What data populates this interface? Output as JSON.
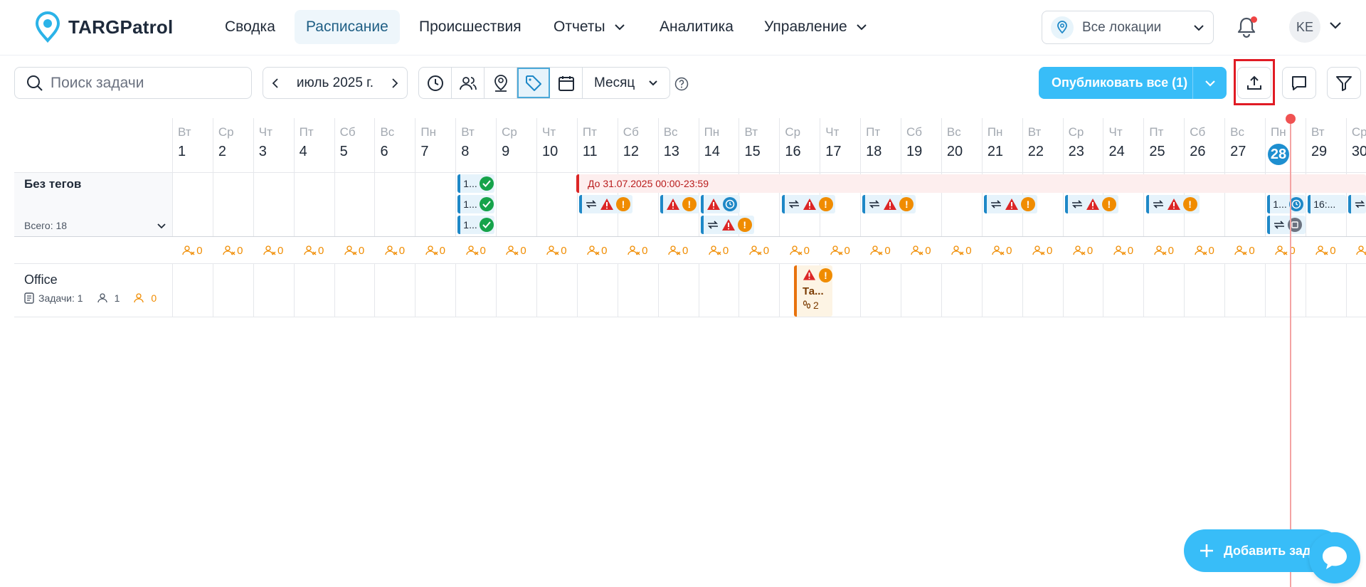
{
  "app": {
    "brand": "TARGPatrol",
    "accent": "#38bdf8",
    "brand_blue": "#1e88c7"
  },
  "nav": {
    "items": [
      {
        "label": "Сводка",
        "active": false,
        "dropdown": false
      },
      {
        "label": "Расписание",
        "active": true,
        "dropdown": false
      },
      {
        "label": "Происшествия",
        "active": false,
        "dropdown": false
      },
      {
        "label": "Отчеты",
        "active": false,
        "dropdown": true
      },
      {
        "label": "Аналитика",
        "active": false,
        "dropdown": false
      },
      {
        "label": "Управление",
        "active": false,
        "dropdown": true
      }
    ],
    "location_select": "Все локации",
    "avatar_initials": "KE"
  },
  "toolbar": {
    "search_placeholder": "Поиск задачи",
    "month_label": "июль 2025 г.",
    "view_mode": "Месяц",
    "publish_label": "Опубликовать все (1)"
  },
  "calendar": {
    "days": [
      {
        "wd": "Вт",
        "d": "1"
      },
      {
        "wd": "Ср",
        "d": "2"
      },
      {
        "wd": "Чт",
        "d": "3"
      },
      {
        "wd": "Пт",
        "d": "4"
      },
      {
        "wd": "Сб",
        "d": "5"
      },
      {
        "wd": "Вс",
        "d": "6"
      },
      {
        "wd": "Пн",
        "d": "7"
      },
      {
        "wd": "Вт",
        "d": "8"
      },
      {
        "wd": "Ср",
        "d": "9"
      },
      {
        "wd": "Чт",
        "d": "10"
      },
      {
        "wd": "Пт",
        "d": "11"
      },
      {
        "wd": "Сб",
        "d": "12"
      },
      {
        "wd": "Вс",
        "d": "13"
      },
      {
        "wd": "Пн",
        "d": "14"
      },
      {
        "wd": "Вт",
        "d": "15"
      },
      {
        "wd": "Ср",
        "d": "16"
      },
      {
        "wd": "Чт",
        "d": "17"
      },
      {
        "wd": "Пт",
        "d": "18"
      },
      {
        "wd": "Сб",
        "d": "19"
      },
      {
        "wd": "Вс",
        "d": "20"
      },
      {
        "wd": "Пн",
        "d": "21"
      },
      {
        "wd": "Вт",
        "d": "22"
      },
      {
        "wd": "Ср",
        "d": "23"
      },
      {
        "wd": "Чт",
        "d": "24"
      },
      {
        "wd": "Пт",
        "d": "25"
      },
      {
        "wd": "Сб",
        "d": "26"
      },
      {
        "wd": "Вс",
        "d": "27"
      },
      {
        "wd": "Пн",
        "d": "28"
      },
      {
        "wd": "Вт",
        "d": "29"
      },
      {
        "wd": "Ср",
        "d": "30"
      }
    ],
    "today": "28",
    "groups": {
      "no_tags": {
        "title": "Без тегов",
        "total": "Всего: 18",
        "banner": "До 31.07.2025 00:00-23:59"
      },
      "office": {
        "title": "Office",
        "tasks": "Задачи: 1",
        "people": "1",
        "unassigned": "0",
        "chip_title": "Та...",
        "chip_count": "2"
      }
    },
    "unassigned_count": "0",
    "chip_short": "1...",
    "chip_time": "16:..."
  },
  "fab_label": "Добавить зад"
}
